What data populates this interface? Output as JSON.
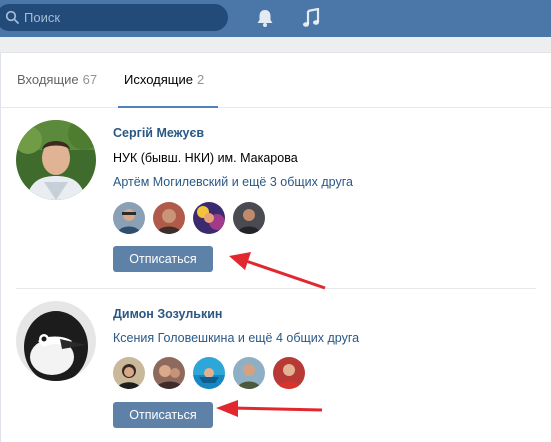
{
  "header": {
    "search_placeholder": "Поиск",
    "icons": [
      "search-icon",
      "bell-icon",
      "music-icon"
    ]
  },
  "tabs": [
    {
      "label": "Входящие",
      "count": "67"
    },
    {
      "label": "Исходящие",
      "count": "2",
      "active": true
    }
  ],
  "requests": [
    {
      "name": "Сергій Межуєв",
      "info": "НУК (бывш. НКИ) им. Макарова",
      "mutual": "Артём Могилевский и ещё 3 общих друга",
      "button": "Отписаться"
    },
    {
      "name": "Димон Зозулькин",
      "mutual": "Ксения Головешкина и ещё 4 общих друга",
      "button": "Отписаться"
    }
  ],
  "colors": {
    "header": "#4a76a8",
    "link": "#2a5885",
    "button": "#5e81a8",
    "arrow": "#e0282e"
  }
}
